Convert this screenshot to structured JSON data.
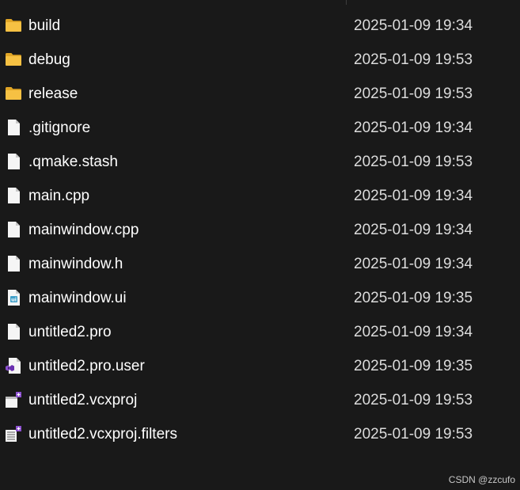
{
  "files": [
    {
      "name": "build",
      "modified": "2025-01-09 19:34",
      "icon": "folder-icon"
    },
    {
      "name": "debug",
      "modified": "2025-01-09 19:53",
      "icon": "folder-icon"
    },
    {
      "name": "release",
      "modified": "2025-01-09 19:53",
      "icon": "folder-icon"
    },
    {
      "name": ".gitignore",
      "modified": "2025-01-09 19:34",
      "icon": "file-icon"
    },
    {
      "name": ".qmake.stash",
      "modified": "2025-01-09 19:53",
      "icon": "file-icon"
    },
    {
      "name": "main.cpp",
      "modified": "2025-01-09 19:34",
      "icon": "file-icon"
    },
    {
      "name": "mainwindow.cpp",
      "modified": "2025-01-09 19:34",
      "icon": "file-icon"
    },
    {
      "name": "mainwindow.h",
      "modified": "2025-01-09 19:34",
      "icon": "file-icon"
    },
    {
      "name": "mainwindow.ui",
      "modified": "2025-01-09 19:35",
      "icon": "qt-ui-file-icon"
    },
    {
      "name": "untitled2.pro",
      "modified": "2025-01-09 19:34",
      "icon": "file-icon"
    },
    {
      "name": "untitled2.pro.user",
      "modified": "2025-01-09 19:35",
      "icon": "visual-studio-file-icon"
    },
    {
      "name": "untitled2.vcxproj",
      "modified": "2025-01-09 19:53",
      "icon": "vcxproj-file-icon"
    },
    {
      "name": "untitled2.vcxproj.filters",
      "modified": "2025-01-09 19:53",
      "icon": "vcxproj-filters-file-icon"
    }
  ],
  "watermark": "CSDN @zzcufo",
  "colors": {
    "background": "#191919",
    "text": "#ffffff",
    "folder": "#f6c143",
    "folder_dark": "#e0a526",
    "file": "#f5f5f5",
    "vs_purple": "#8c4fd0",
    "ui_blue": "#41a0c9"
  }
}
